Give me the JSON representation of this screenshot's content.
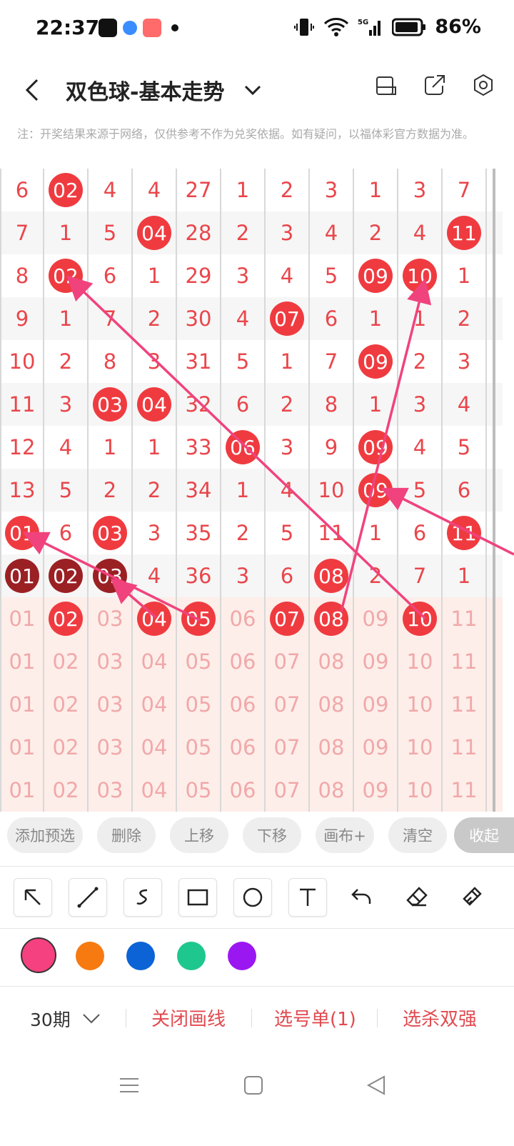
{
  "status": {
    "time": "22:37",
    "battery": "86%",
    "network": "5G"
  },
  "header": {
    "title": "双色球-基本走势"
  },
  "note": "注：开奖结果来源于网络，仅供参考不作为兑奖依据。如有疑问，以福体彩官方数据为准。",
  "grid_rows": [
    [
      {
        "v": "6"
      },
      {
        "v": "02",
        "b": 1
      },
      {
        "v": "4"
      },
      {
        "v": "4"
      },
      {
        "v": "27"
      },
      {
        "v": "1"
      },
      {
        "v": "2"
      },
      {
        "v": "3"
      },
      {
        "v": "1"
      },
      {
        "v": "3"
      },
      {
        "v": "7"
      }
    ],
    [
      {
        "v": "7"
      },
      {
        "v": "1"
      },
      {
        "v": "5"
      },
      {
        "v": "04",
        "b": 1
      },
      {
        "v": "28"
      },
      {
        "v": "2"
      },
      {
        "v": "3"
      },
      {
        "v": "4"
      },
      {
        "v": "2"
      },
      {
        "v": "4"
      },
      {
        "v": "11",
        "b": 1
      }
    ],
    [
      {
        "v": "8"
      },
      {
        "v": "02",
        "b": 1
      },
      {
        "v": "6"
      },
      {
        "v": "1"
      },
      {
        "v": "29"
      },
      {
        "v": "3"
      },
      {
        "v": "4"
      },
      {
        "v": "5"
      },
      {
        "v": "09",
        "b": 1
      },
      {
        "v": "10",
        "b": 1
      },
      {
        "v": "1"
      }
    ],
    [
      {
        "v": "9"
      },
      {
        "v": "1"
      },
      {
        "v": "7"
      },
      {
        "v": "2"
      },
      {
        "v": "30"
      },
      {
        "v": "4"
      },
      {
        "v": "07",
        "b": 1
      },
      {
        "v": "6"
      },
      {
        "v": "1"
      },
      {
        "v": "1"
      },
      {
        "v": "2"
      }
    ],
    [
      {
        "v": "10"
      },
      {
        "v": "2"
      },
      {
        "v": "8"
      },
      {
        "v": "3"
      },
      {
        "v": "31"
      },
      {
        "v": "5"
      },
      {
        "v": "1"
      },
      {
        "v": "7"
      },
      {
        "v": "09",
        "b": 1
      },
      {
        "v": "2"
      },
      {
        "v": "3"
      }
    ],
    [
      {
        "v": "11"
      },
      {
        "v": "3"
      },
      {
        "v": "03",
        "b": 1
      },
      {
        "v": "04",
        "b": 1
      },
      {
        "v": "32"
      },
      {
        "v": "6"
      },
      {
        "v": "2"
      },
      {
        "v": "8"
      },
      {
        "v": "1"
      },
      {
        "v": "3"
      },
      {
        "v": "4"
      }
    ],
    [
      {
        "v": "12"
      },
      {
        "v": "4"
      },
      {
        "v": "1"
      },
      {
        "v": "1"
      },
      {
        "v": "33"
      },
      {
        "v": "06",
        "b": 1
      },
      {
        "v": "3"
      },
      {
        "v": "9"
      },
      {
        "v": "09",
        "b": 1
      },
      {
        "v": "4"
      },
      {
        "v": "5"
      }
    ],
    [
      {
        "v": "13"
      },
      {
        "v": "5"
      },
      {
        "v": "2"
      },
      {
        "v": "2"
      },
      {
        "v": "34"
      },
      {
        "v": "1"
      },
      {
        "v": "4"
      },
      {
        "v": "10"
      },
      {
        "v": "09",
        "b": 1
      },
      {
        "v": "5"
      },
      {
        "v": "6"
      }
    ],
    [
      {
        "v": "01",
        "b": 1
      },
      {
        "v": "6"
      },
      {
        "v": "03",
        "b": 1
      },
      {
        "v": "3"
      },
      {
        "v": "35"
      },
      {
        "v": "2"
      },
      {
        "v": "5"
      },
      {
        "v": "11"
      },
      {
        "v": "1"
      },
      {
        "v": "6"
      },
      {
        "v": "11",
        "b": 1
      }
    ],
    [
      {
        "v": "01",
        "b": 2
      },
      {
        "v": "02",
        "b": 2
      },
      {
        "v": "03",
        "b": 2
      },
      {
        "v": "4"
      },
      {
        "v": "36"
      },
      {
        "v": "3"
      },
      {
        "v": "6"
      },
      {
        "v": "08",
        "b": 1
      },
      {
        "v": "2"
      },
      {
        "v": "7"
      },
      {
        "v": "1"
      }
    ],
    [
      {
        "v": "01",
        "f": 1
      },
      {
        "v": "02",
        "b": 1
      },
      {
        "v": "03",
        "f": 1
      },
      {
        "v": "04",
        "b": 1
      },
      {
        "v": "05",
        "b": 1
      },
      {
        "v": "06",
        "f": 1
      },
      {
        "v": "07",
        "b": 1
      },
      {
        "v": "08",
        "b": 1
      },
      {
        "v": "09",
        "f": 1
      },
      {
        "v": "10",
        "b": 1
      },
      {
        "v": "11",
        "f": 1
      }
    ],
    [
      {
        "v": "01",
        "f": 1
      },
      {
        "v": "02",
        "f": 1
      },
      {
        "v": "03",
        "f": 1
      },
      {
        "v": "04",
        "f": 1
      },
      {
        "v": "05",
        "f": 1
      },
      {
        "v": "06",
        "f": 1
      },
      {
        "v": "07",
        "f": 1
      },
      {
        "v": "08",
        "f": 1
      },
      {
        "v": "09",
        "f": 1
      },
      {
        "v": "10",
        "f": 1
      },
      {
        "v": "11",
        "f": 1
      }
    ],
    [
      {
        "v": "01",
        "f": 1
      },
      {
        "v": "02",
        "f": 1
      },
      {
        "v": "03",
        "f": 1
      },
      {
        "v": "04",
        "f": 1
      },
      {
        "v": "05",
        "f": 1
      },
      {
        "v": "06",
        "f": 1
      },
      {
        "v": "07",
        "f": 1
      },
      {
        "v": "08",
        "f": 1
      },
      {
        "v": "09",
        "f": 1
      },
      {
        "v": "10",
        "f": 1
      },
      {
        "v": "11",
        "f": 1
      }
    ],
    [
      {
        "v": "01",
        "f": 1
      },
      {
        "v": "02",
        "f": 1
      },
      {
        "v": "03",
        "f": 1
      },
      {
        "v": "04",
        "f": 1
      },
      {
        "v": "05",
        "f": 1
      },
      {
        "v": "06",
        "f": 1
      },
      {
        "v": "07",
        "f": 1
      },
      {
        "v": "08",
        "f": 1
      },
      {
        "v": "09",
        "f": 1
      },
      {
        "v": "10",
        "f": 1
      },
      {
        "v": "11",
        "f": 1
      }
    ],
    [
      {
        "v": "01",
        "f": 1
      },
      {
        "v": "02",
        "f": 1
      },
      {
        "v": "03",
        "f": 1
      },
      {
        "v": "04",
        "f": 1
      },
      {
        "v": "05",
        "f": 1
      },
      {
        "v": "06",
        "f": 1
      },
      {
        "v": "07",
        "f": 1
      },
      {
        "v": "08",
        "f": 1
      },
      {
        "v": "09",
        "f": 1
      },
      {
        "v": "10",
        "f": 1
      },
      {
        "v": "11",
        "f": 1
      }
    ]
  ],
  "toolbar": {
    "add": "添加预选",
    "delete": "删除",
    "up": "上移",
    "down": "下移",
    "canvas": "画布+",
    "clear": "清空",
    "collapse": "收起"
  },
  "draw_tools": [
    "arrow-icon",
    "line-icon",
    "freehand-icon",
    "rectangle-icon",
    "circle-icon",
    "text-icon",
    "undo-icon",
    "eraser-icon",
    "clear-brush-icon"
  ],
  "colors": [
    "#f5417f",
    "#f77a10",
    "#0b63d6",
    "#1ec78d",
    "#9b17f2"
  ],
  "selected_color": "#f5417f",
  "bottom": {
    "period": "30期",
    "close_lines": "关闭画线",
    "pick_list": "选号单(1)",
    "kill_double": "选杀双强"
  },
  "nav": [
    "menu-icon",
    "home-icon",
    "back-icon"
  ]
}
